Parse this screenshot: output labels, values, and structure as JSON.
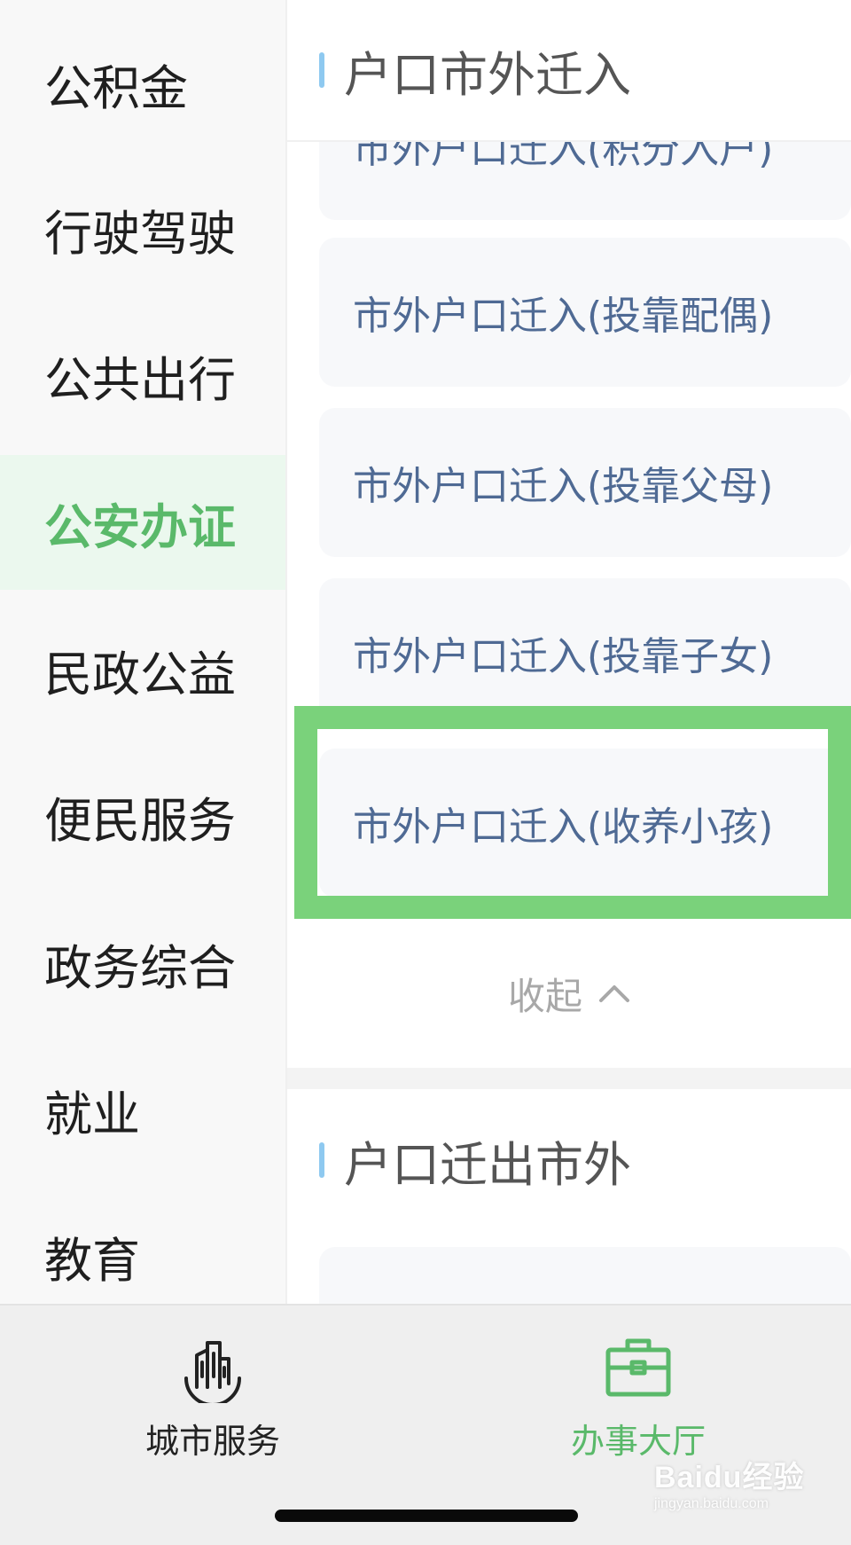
{
  "sidebar": {
    "items": [
      {
        "label": "公积金"
      },
      {
        "label": "行驶驾驶"
      },
      {
        "label": "公共出行"
      },
      {
        "label": "公安办证"
      },
      {
        "label": "民政公益"
      },
      {
        "label": "便民服务"
      },
      {
        "label": "政务综合"
      },
      {
        "label": "就业"
      },
      {
        "label": "教育"
      }
    ],
    "active_index": 3
  },
  "main": {
    "section_in": {
      "title": "户口市外迁入",
      "items": [
        {
          "label": "市外户口迁入(积分入户)"
        },
        {
          "label": "市外户口迁入(投靠配偶)"
        },
        {
          "label": "市外户口迁入(投靠父母)"
        },
        {
          "label": "市外户口迁入(投靠子女)"
        },
        {
          "label": "市外户口迁入(收养小孩)"
        }
      ],
      "collapse_label": "收起"
    },
    "section_out": {
      "title": "户口迁出市外"
    }
  },
  "tabbar": {
    "tabs": [
      {
        "label": "城市服务",
        "icon": "city-buildings-icon"
      },
      {
        "label": "办事大厅",
        "icon": "briefcase-icon"
      }
    ],
    "active_index": 1
  },
  "watermark": {
    "main": "Baidu经验",
    "sub": "jingyan.baidu.com"
  },
  "colors": {
    "accent": "#5ab96a",
    "highlight_border": "#7ad27b",
    "item_text": "#4f6a94",
    "section_bar": "#8ec9f0"
  }
}
